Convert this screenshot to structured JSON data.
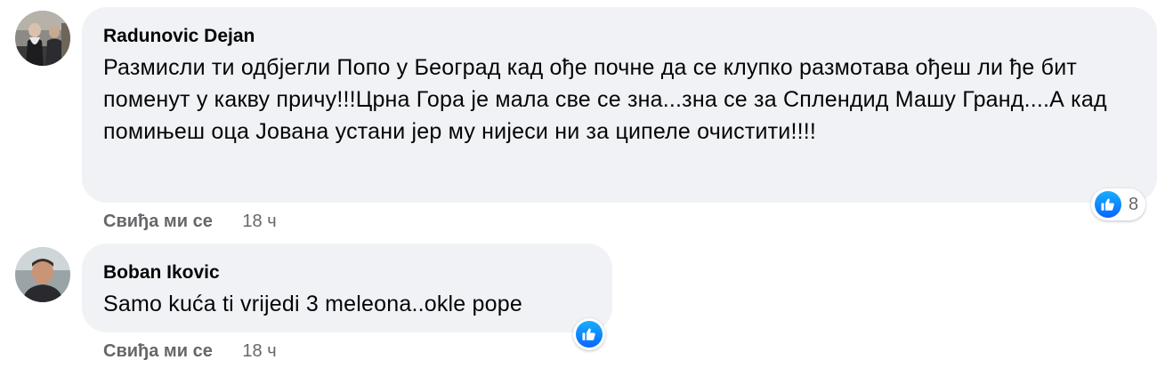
{
  "colors": {
    "bubble_bg": "#f0f2f5",
    "text": "#050505",
    "secondary_text": "#65676b",
    "like_blue": "#0866ff"
  },
  "comments": [
    {
      "author": "Radunovic Dejan",
      "text": "Размисли ти одбјегли Попо у Београд кад ође почне да се клупко размотава ођеш ли ђе бит поменут у какву причу!!!Црна Гора је мала све се зна...зна се за Сплендид Машу Гранд....А кад помињеш оца Јована устани јер му нијеси ни за ципеле очистити!!!!",
      "like_action": "Свиђа ми се",
      "time": "18 ч",
      "reaction_icon": "like-icon",
      "reaction_count": "8"
    },
    {
      "author": "Boban Ikovic",
      "text": "Samo kuća ti vrijedi 3 meleona..okle pope",
      "like_action": "Свиђа ми се",
      "time": "18 ч",
      "reaction_icon": "like-icon",
      "reaction_count": ""
    }
  ]
}
